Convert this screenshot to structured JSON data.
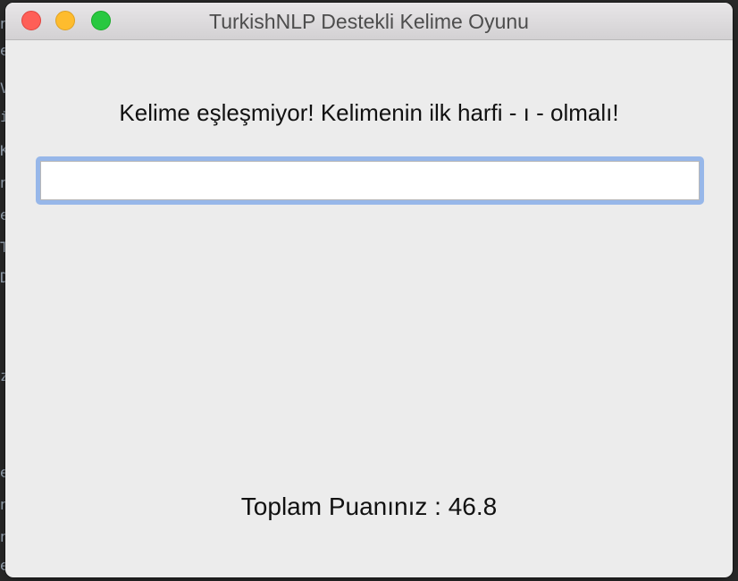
{
  "window": {
    "title": "TurkishNLP Destekli Kelime Oyunu"
  },
  "game": {
    "message": "Kelime eşleşmiyor! Kelimenin ilk harfi - ı - olmalı!",
    "input_value": "",
    "score_text": "Toplam Puanınız : 46.8"
  },
  "colors": {
    "window_bg": "#ececec",
    "focus_ring": "#97b7e9",
    "close": "#fe5f57",
    "minimize": "#febc2e",
    "maximize": "#28c840"
  },
  "background_editor": {
    "fragments": [
      "n",
      "e",
      "V",
      "ii",
      "K",
      "n",
      "e",
      "T",
      "D",
      "z",
      "e",
      "n",
      "n",
      "e"
    ]
  }
}
